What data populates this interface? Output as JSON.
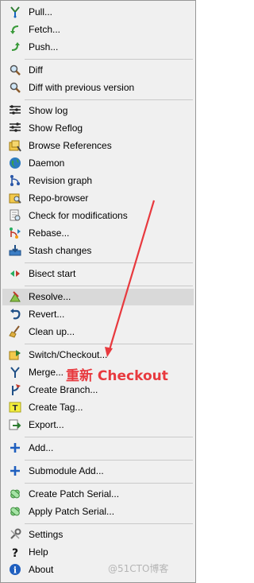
{
  "menu": {
    "pull": {
      "label": "Pull..."
    },
    "fetch": {
      "label": "Fetch..."
    },
    "push": {
      "label": "Push..."
    },
    "diff": {
      "label": "Diff"
    },
    "diff_prev": {
      "label": "Diff with previous version"
    },
    "show_log": {
      "label": "Show log"
    },
    "show_reflog": {
      "label": "Show Reflog"
    },
    "browse_refs": {
      "label": "Browse References"
    },
    "daemon": {
      "label": "Daemon"
    },
    "revision_graph": {
      "label": "Revision graph"
    },
    "repo_browser": {
      "label": "Repo-browser"
    },
    "check_mods": {
      "label": "Check for modifications"
    },
    "rebase": {
      "label": "Rebase..."
    },
    "stash": {
      "label": "Stash changes"
    },
    "bisect": {
      "label": "Bisect start"
    },
    "resolve": {
      "label": "Resolve..."
    },
    "revert": {
      "label": "Revert..."
    },
    "cleanup": {
      "label": "Clean up..."
    },
    "switch": {
      "label": "Switch/Checkout..."
    },
    "merge": {
      "label": "Merge..."
    },
    "create_branch": {
      "label": "Create Branch..."
    },
    "create_tag": {
      "label": "Create Tag..."
    },
    "export": {
      "label": "Export..."
    },
    "add": {
      "label": "Add..."
    },
    "submodule_add": {
      "label": "Submodule Add..."
    },
    "create_patch": {
      "label": "Create Patch Serial..."
    },
    "apply_patch": {
      "label": "Apply Patch Serial..."
    },
    "settings": {
      "label": "Settings"
    },
    "help": {
      "label": "Help"
    },
    "about": {
      "label": "About"
    }
  },
  "highlighted_item": "Resolve...",
  "annotation": {
    "text": "重新 Checkout",
    "color": "#e8393e"
  },
  "watermark": "@51CTO博客",
  "colors": {
    "menu_bg": "#f0f0f0",
    "highlight": "#d9d9d9",
    "separator": "#c9c9c9",
    "annotation": "#e8393e"
  }
}
